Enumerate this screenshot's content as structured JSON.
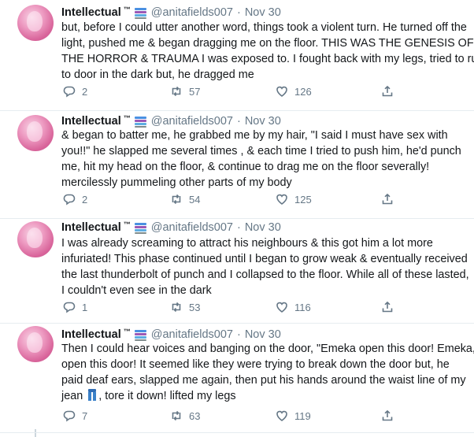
{
  "author": {
    "name": "Intellectual",
    "tm": "™",
    "handle": "@anitafields007",
    "separator": "·",
    "emoji_icon": "books-icon"
  },
  "tweets": [
    {
      "date": "Nov 30",
      "lines": [
        "but, before I could utter another word, things took a violent turn. He turned off the",
        "light, pushed me & began dragging me on the floor. THIS WAS THE GENESIS OF",
        "THE HORROR & TRAUMA I was exposed to. I fought back with my legs, tried to run",
        "to door in the dark but, he dragged me"
      ],
      "replies": "2",
      "retweets": "57",
      "likes": "126"
    },
    {
      "date": "Nov 30",
      "lines": [
        "& began to batter me, he grabbed me by my hair, \"I said I must have sex with",
        "you!!\" he slapped me several times , & each time I tried to push him, he'd punch",
        "me, hit my head on the floor, & continue to drag me on the floor severally!",
        "mercilessly pummeling other parts of my body"
      ],
      "replies": "2",
      "retweets": "54",
      "likes": "125"
    },
    {
      "date": "Nov 30",
      "lines": [
        "I was already screaming to attract his neighbours & this got him a lot more",
        "infuriated! This phase continued until I began to grow weak & eventually received",
        "the last thunderbolt of punch and I collapsed to the floor. While all of these lasted,",
        "I couldn't even see in the dark"
      ],
      "replies": "1",
      "retweets": "53",
      "likes": "116"
    },
    {
      "date": "Nov 30",
      "lines": [
        "Then I could hear voices and banging on the door, \"Emeka open this door! Emeka,",
        "open this door! It seemed like they were trying to break down the door but, he",
        "paid deaf ears, slapped me again, then put his hands around the waist line of my"
      ],
      "last_line_start": "jean",
      "last_line_icon": "jeans-icon",
      "last_line_end": ", tore it down! lifted my legs",
      "replies": "7",
      "retweets": "63",
      "likes": "119"
    }
  ]
}
